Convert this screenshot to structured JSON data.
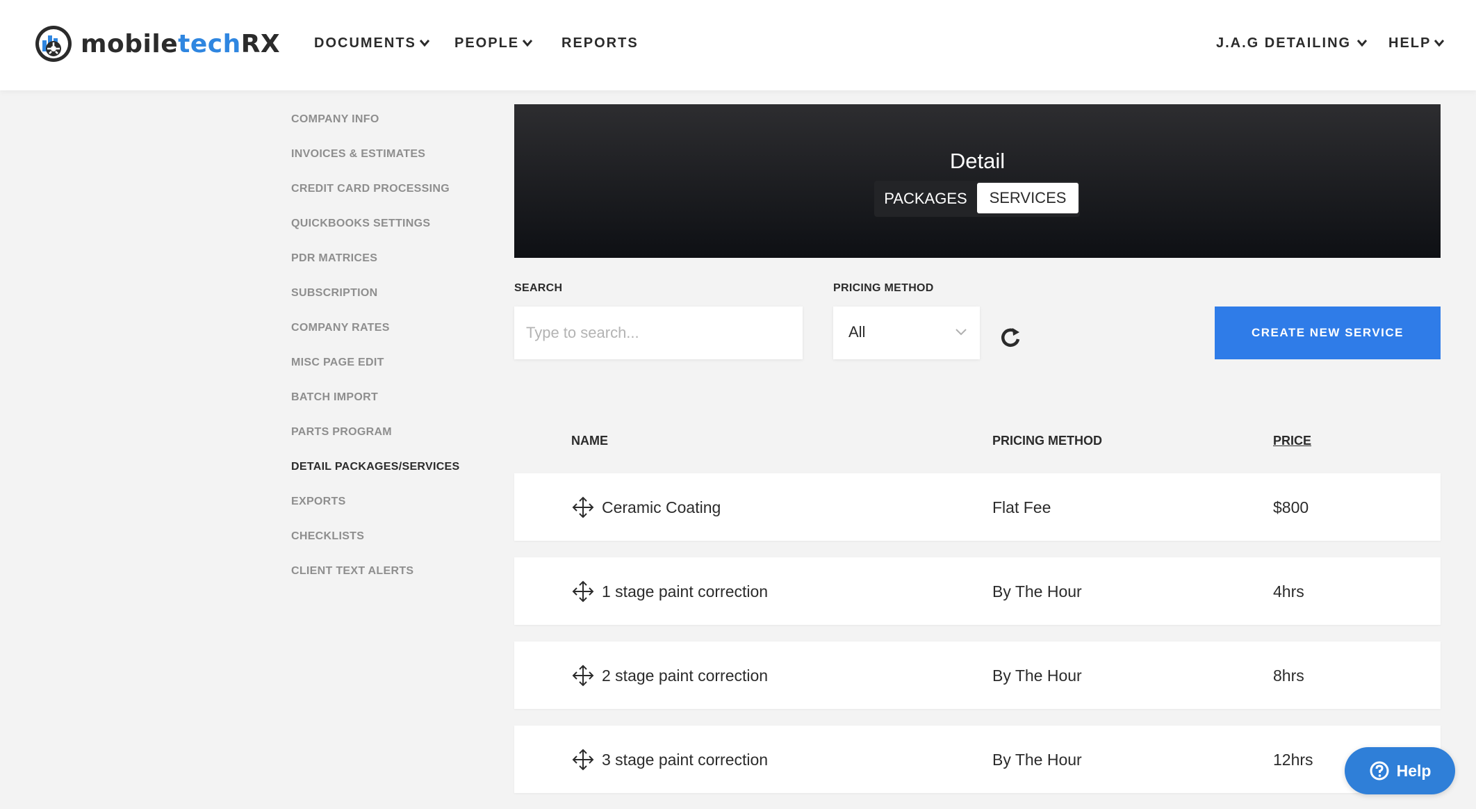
{
  "brand": {
    "name_part1": "mobile",
    "name_part2": "tech",
    "name_part3": "RX",
    "accent_color": "#2f86e0"
  },
  "nav": {
    "documents": "DOCUMENTS",
    "people": "PEOPLE",
    "reports": "REPORTS",
    "company": "J.A.G DETAILING",
    "help": "HELP"
  },
  "sidebar": {
    "items": [
      "COMPANY INFO",
      "INVOICES & ESTIMATES",
      "CREDIT CARD PROCESSING",
      "QUICKBOOKS SETTINGS",
      "PDR MATRICES",
      "SUBSCRIPTION",
      "COMPANY RATES",
      "MISC PAGE EDIT",
      "BATCH IMPORT",
      "PARTS PROGRAM",
      "DETAIL PACKAGES/SERVICES",
      "EXPORTS",
      "CHECKLISTS",
      "CLIENT TEXT ALERTS"
    ],
    "active": "DETAIL PACKAGES/SERVICES"
  },
  "hero": {
    "title": "Detail",
    "tabs": [
      "PACKAGES",
      "SERVICES"
    ],
    "active_tab": "SERVICES"
  },
  "filters": {
    "search_label": "SEARCH",
    "search_placeholder": "Type to search...",
    "search_value": "",
    "pricing_label": "PRICING METHOD",
    "pricing_value": "All",
    "create_button": "CREATE NEW SERVICE",
    "button_color": "#2f7ce8"
  },
  "table": {
    "headers": {
      "name": "NAME",
      "method": "PRICING METHOD",
      "price": "PRICE"
    },
    "rows": [
      {
        "name": "Ceramic Coating",
        "method": "Flat Fee",
        "price": "$800"
      },
      {
        "name": "1 stage paint correction",
        "method": "By The Hour",
        "price": "4hrs"
      },
      {
        "name": "2 stage paint correction",
        "method": "By The Hour",
        "price": "8hrs"
      },
      {
        "name": "3 stage paint correction",
        "method": "By The Hour",
        "price": "12hrs"
      }
    ]
  },
  "help_widget": {
    "label": "Help"
  },
  "icons": {
    "nav_dropdown": "chevron-down-icon",
    "row_drag": "move-arrows-icon",
    "refresh": "refresh-icon",
    "help": "question-circle-icon"
  }
}
